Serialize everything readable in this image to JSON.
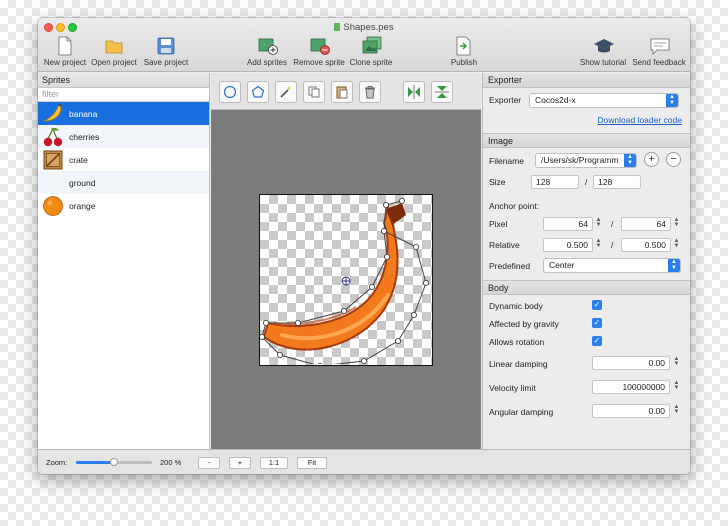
{
  "window": {
    "title": "Shapes.pes"
  },
  "toolbar": {
    "new_project": "New project",
    "open_project": "Open project",
    "save_project": "Save project",
    "add_sprites": "Add sprites",
    "remove_sprite": "Remove sprite",
    "clone_sprite": "Clone sprite",
    "publish": "Publish",
    "show_tutorial": "Show tutorial",
    "send_feedback": "Send feedback"
  },
  "sprites": {
    "header": "Sprites",
    "filter_placeholder": "filter",
    "items": [
      {
        "label": "banana",
        "selected": true,
        "icon": "banana-icon"
      },
      {
        "label": "cherries",
        "selected": false,
        "icon": "cherries-icon"
      },
      {
        "label": "crate",
        "selected": false,
        "icon": "crate-icon"
      },
      {
        "label": "ground",
        "selected": false,
        "icon": ""
      },
      {
        "label": "orange",
        "selected": false,
        "icon": "orange-icon"
      }
    ]
  },
  "canvas_tools": [
    "circle-icon",
    "polygon-icon",
    "magic-wand-icon",
    "copy-icon",
    "paste-icon",
    "trash-icon",
    "flip-horizontal-icon",
    "flip-vertical-icon"
  ],
  "exporter": {
    "header": "Exporter",
    "label": "Exporter",
    "value": "Cocos2d-x",
    "download_link": "Download loader code"
  },
  "image": {
    "header": "Image",
    "filename_label": "Filename",
    "filename_value": "/Users/sk/Programm",
    "size_label": "Size",
    "width": "128",
    "height": "128",
    "separator": "/",
    "anchor_label": "Anchor point:",
    "pixel_label": "Pixel",
    "pixel_x": "64",
    "pixel_y": "64",
    "relative_label": "Relative",
    "relative_x": "0.500",
    "relative_y": "0.500",
    "predefined_label": "Predefined",
    "predefined_value": "Center"
  },
  "body": {
    "header": "Body",
    "dynamic_body": "Dynamic body",
    "affected_by_gravity": "Affected by gravity",
    "allows_rotation": "Allows rotation",
    "linear_damping_label": "Linear damping",
    "linear_damping": "0.00",
    "velocity_limit_label": "Velocity limit",
    "velocity_limit": "100000000",
    "angular_damping_label": "Angular damping",
    "angular_damping": "0.00"
  },
  "bottom": {
    "zoom_label": "Zoom:",
    "zoom_value": "200 %",
    "zoom_level": 0.5,
    "minus": "-",
    "plus": "+",
    "one_to_one": "1:1",
    "fit": "Fit"
  },
  "colors": {
    "selection": "#1a6fde",
    "accent": "#2a7ff0",
    "banana": "#f27a1d",
    "canvas_bg": "#7b7b7b"
  }
}
